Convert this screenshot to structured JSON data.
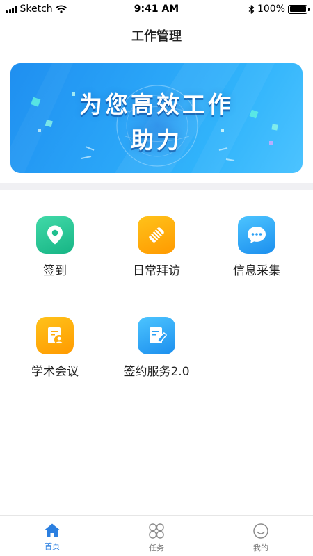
{
  "status_bar": {
    "carrier": "Sketch",
    "time": "9:41 AM",
    "battery": "100%",
    "battery_level": 1.0
  },
  "nav": {
    "title": "工作管理"
  },
  "banner": {
    "line1": "为您高效工作",
    "line2": "助力"
  },
  "grid": [
    {
      "label": "签到",
      "icon": "location-pin-icon",
      "color": "#1fbf8f"
    },
    {
      "label": "日常拜访",
      "icon": "handshake-icon",
      "color": "#ffab0a"
    },
    {
      "label": "信息采集",
      "icon": "chat-bubble-icon",
      "color": "#2aa0f5"
    },
    {
      "label": "学术会议",
      "icon": "meeting-doc-icon",
      "color": "#ffab0a"
    },
    {
      "label": "签约服务2.0",
      "icon": "sign-doc-icon",
      "color": "#2aa0f5"
    }
  ],
  "tabs": [
    {
      "label": "首页",
      "icon": "home-icon",
      "active": true
    },
    {
      "label": "任务",
      "icon": "grid-icon",
      "active": false
    },
    {
      "label": "我的",
      "icon": "smiley-icon",
      "active": false
    }
  ],
  "colors": {
    "accent": "#2b7fe0",
    "inactive": "#7a7a7a",
    "banner": "#2aa6f8"
  }
}
